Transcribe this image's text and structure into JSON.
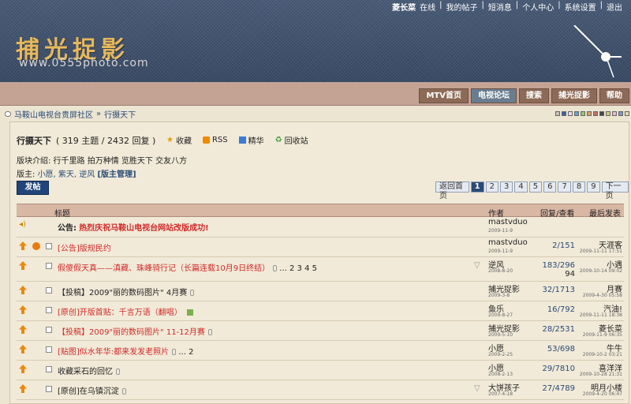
{
  "header": {
    "links": [
      "菱长菜",
      "在线",
      "我的帖子",
      "短消息",
      "个人中心",
      "系统设置",
      "退出"
    ],
    "logo": "捕光捉影",
    "site": "www.0555photo.com"
  },
  "nav": {
    "tabs": [
      "MTV首页",
      "电视论坛",
      "搜索",
      "捕光捉影",
      "帮助"
    ]
  },
  "breadcrumb": {
    "home": "马鞍山电视台贵屏社区",
    "sep": "»",
    "current": "行摄天下"
  },
  "forum": {
    "title": "行摄天下",
    "stats": "( 319 主题 / 2432 回复 )",
    "actions": [
      "收藏",
      "RSS",
      "精华",
      "回收站"
    ],
    "intro": "版块介绍: 行千里路 拍万种情 览胜天下 交友八方",
    "mods_label": "版主:",
    "mods": "小愿, 紫天, 逆风",
    "mods_manage": "[版主管理]",
    "post_button": "发帖"
  },
  "pager": {
    "first": "返回首页",
    "pages": [
      "1",
      "2",
      "3",
      "4",
      "5",
      "6",
      "7",
      "8",
      "9"
    ],
    "next": "下一页"
  },
  "table": {
    "headers": {
      "title": "标题",
      "author": "作者",
      "replies": "回复/查看",
      "last": "最后发表"
    },
    "rows": [
      {
        "title_prefix": "公告:",
        "title": "热烈庆祝马鞍山电视台网站改版成功!",
        "author": "mastvduo",
        "author_date": "2009-11-9",
        "replies": "",
        "last": "",
        "last_date": ""
      },
      {
        "title": "[公告]版规民约",
        "author": "mastvduo",
        "author_date": "2009-11-9",
        "replies": "2/151",
        "last": "天涯客",
        "last_date": "2009-11-11 17:51"
      },
      {
        "title": "假傻假天真——滇藏、珠峰骑行记（长篇连载10月9日终结）",
        "pages": "... 2 3 4 5",
        "author": "逆风",
        "author_date": "2008-8-20",
        "replies": "183/296",
        "replies2": "94",
        "last": "小遇",
        "last_date": "2009-10-14 09:02"
      },
      {
        "title": "【投稿】2009\"丽的数码图片\" 4月赛",
        "author": "捕光捉影",
        "author_date": "2009-3-8",
        "replies": "32/1713",
        "last": "月赛",
        "last_date": "2009-4-30 05:58"
      },
      {
        "title": "[原创]开版首贴：千言万语（翻唱）",
        "author": "鱼乐",
        "author_date": "2009-8-27",
        "replies": "16/792",
        "last": "汽油!",
        "last_date": "2009-11-11 18:38"
      },
      {
        "title": "【投稿】2009\"丽的数码图片\" 11-12月赛",
        "author": "捕光捉影",
        "author_date": "2009-5-10",
        "replies": "28/2531",
        "last": "菱长菜",
        "last_date": "2009-11-9 06:35"
      },
      {
        "title": "[贴图]似水年华:都来发发老照片",
        "pages": "... 2",
        "author": "小愿",
        "author_date": "2009-2-25",
        "replies": "53/698",
        "last": "牛牛",
        "last_date": "2009-10-2 03:21"
      },
      {
        "title": "收藏采石的回忆",
        "author": "小愿",
        "author_date": "2008-2-13",
        "replies": "29/7810",
        "last": "喜洋洋",
        "last_date": "2009-10-28 21:31"
      },
      {
        "title": "[原创]在乌镇沉淀",
        "author": "大饼孩子",
        "author_date": "2007-4-18",
        "replies": "27/4789",
        "last": "明月小楼",
        "last_date": "2009-4-20 06:47"
      }
    ]
  }
}
